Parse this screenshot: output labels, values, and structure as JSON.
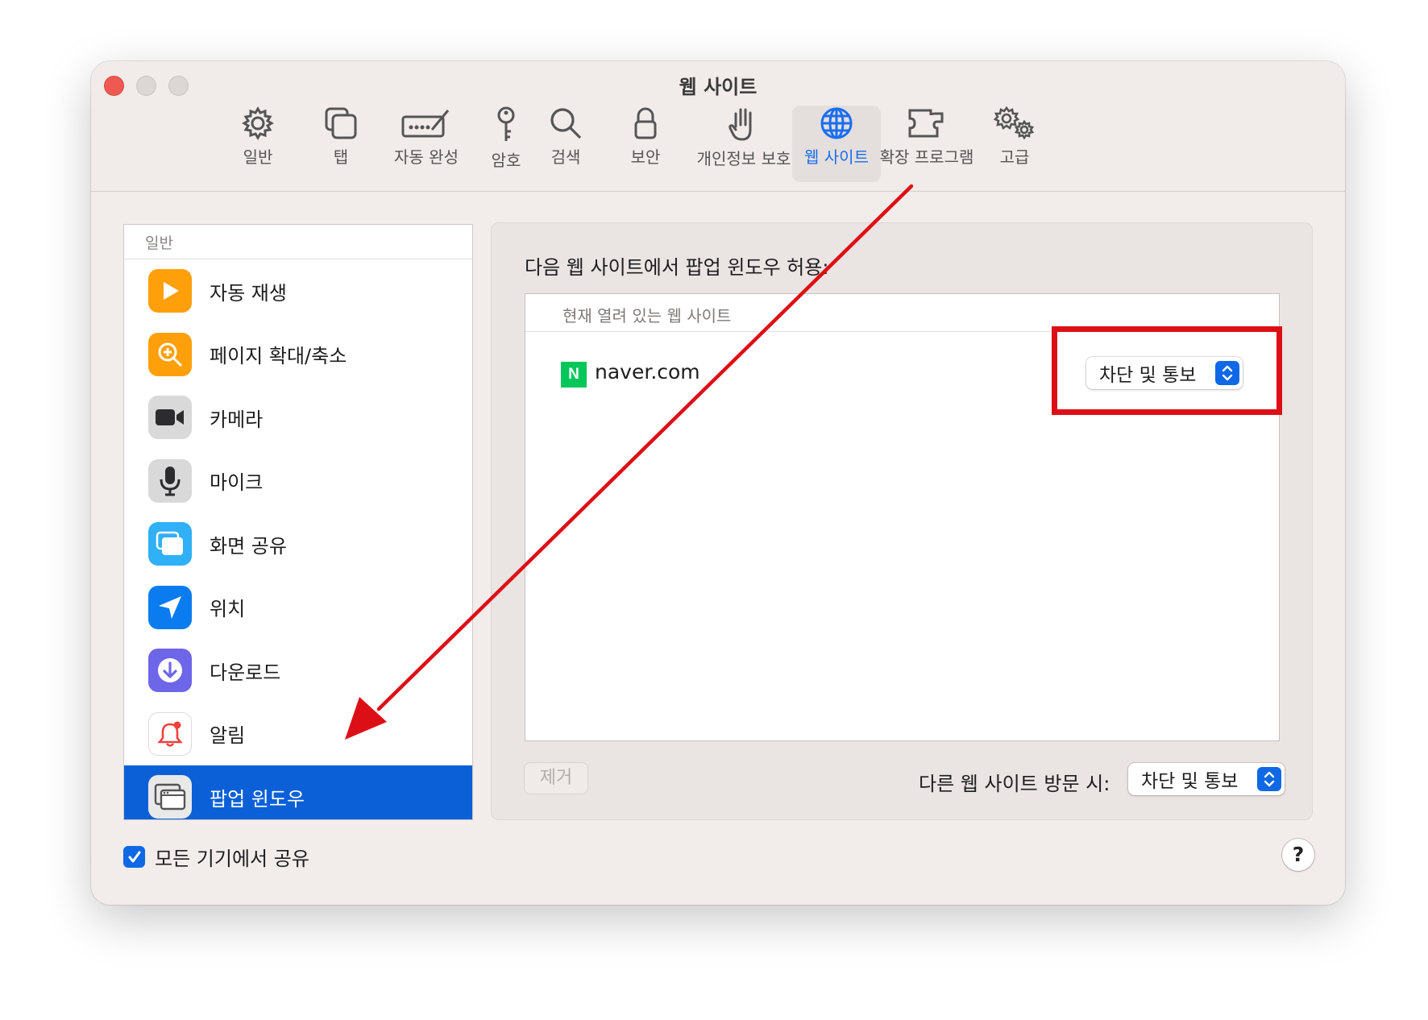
{
  "window": {
    "title": "웹 사이트"
  },
  "toolbar": {
    "items": [
      {
        "label": "일반",
        "icon": "gear-icon"
      },
      {
        "label": "탭",
        "icon": "tabs-icon"
      },
      {
        "label": "자동 완성",
        "icon": "autofill-pen-icon"
      },
      {
        "label": "암호",
        "icon": "key-icon"
      },
      {
        "label": "검색",
        "icon": "magnifier-icon"
      },
      {
        "label": "보안",
        "icon": "lock-icon"
      },
      {
        "label": "개인정보 보호",
        "icon": "hand-icon"
      },
      {
        "label": "웹 사이트",
        "icon": "globe-icon",
        "active": true
      },
      {
        "label": "확장 프로그램",
        "icon": "puzzle-icon"
      },
      {
        "label": "고급",
        "icon": "gears-icon"
      }
    ],
    "active_color": "#1a6ef0"
  },
  "sidebar": {
    "section_header": "일반",
    "items": [
      {
        "label": "자동 재생",
        "icon": "play-icon"
      },
      {
        "label": "페이지 확대/축소",
        "icon": "zoom-icon"
      },
      {
        "label": "카메라",
        "icon": "camera-icon"
      },
      {
        "label": "마이크",
        "icon": "microphone-icon"
      },
      {
        "label": "화면 공유",
        "icon": "screen-share-icon"
      },
      {
        "label": "위치",
        "icon": "location-arrow-icon"
      },
      {
        "label": "다운로드",
        "icon": "download-icon"
      },
      {
        "label": "알림",
        "icon": "bell-icon"
      },
      {
        "label": "팝업 윈도우",
        "icon": "popup-window-icon",
        "selected": true
      }
    ],
    "selected_color": "#0b60d8"
  },
  "main": {
    "description": "다음 웹 사이트에서 팝업 윈도우 허용:",
    "list_header": "현재 열려 있는 웹 사이트",
    "sites": [
      {
        "favicon_letter": "N",
        "name": "naver.com",
        "setting": "차단 및 통보"
      }
    ],
    "remove_button": "제거",
    "other_sites_label": "다른 웹 사이트 방문 시:",
    "other_sites_value": "차단 및 통보"
  },
  "footer": {
    "share_label": "모든 기기에서 공유",
    "share_checked": true,
    "help_label": "?"
  },
  "annotation": {
    "color": "#dd0f16"
  }
}
